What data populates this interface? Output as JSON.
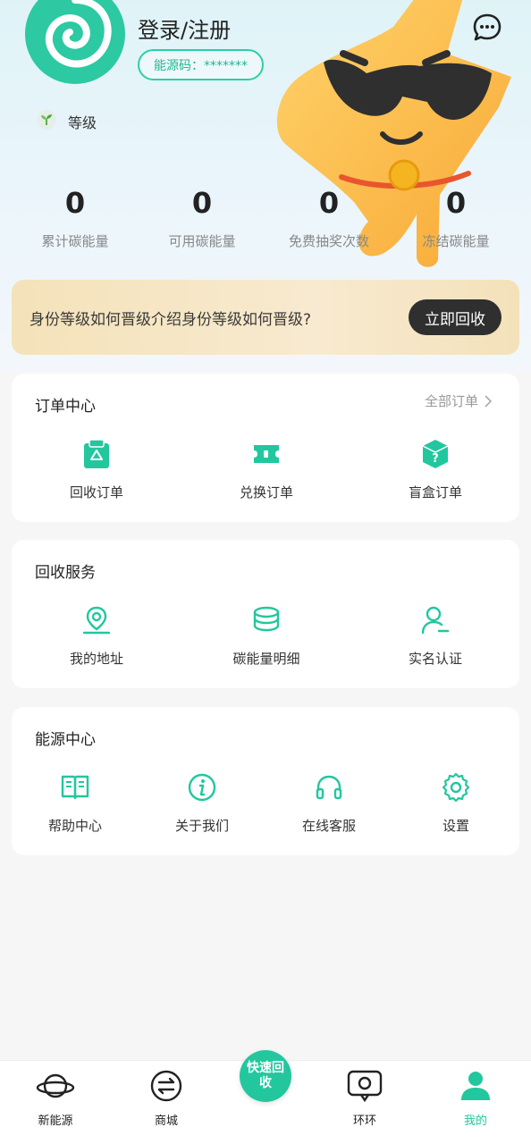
{
  "profile": {
    "login_label": "登录/注册",
    "energy_code": "能源码：*******",
    "level_label": "等级"
  },
  "stats": [
    {
      "value": "0",
      "label": "累计碳能量"
    },
    {
      "value": "0",
      "label": "可用碳能量"
    },
    {
      "value": "0",
      "label": "免费抽奖次数"
    },
    {
      "value": "0",
      "label": "冻结碳能量"
    }
  ],
  "banner": {
    "text": "身份等级如何晋级介绍身份等级如何晋级?",
    "button": "立即回收"
  },
  "orders": {
    "title": "订单中心",
    "link": "全部订单",
    "items": [
      {
        "label": "回收订单",
        "icon": "recycle-bin-icon"
      },
      {
        "label": "兑换订单",
        "icon": "ticket-icon"
      },
      {
        "label": "盲盒订单",
        "icon": "mystery-box-icon"
      }
    ]
  },
  "recycle": {
    "title": "回收服务",
    "items": [
      {
        "label": "我的地址",
        "icon": "location-pin-icon"
      },
      {
        "label": "碳能量明细",
        "icon": "coin-stack-icon"
      },
      {
        "label": "实名认证",
        "icon": "user-verify-icon"
      }
    ]
  },
  "energy": {
    "title": "能源中心",
    "items": [
      {
        "label": "帮助中心",
        "icon": "book-icon"
      },
      {
        "label": "关于我们",
        "icon": "info-icon"
      },
      {
        "label": "在线客服",
        "icon": "headset-icon"
      },
      {
        "label": "设置",
        "icon": "gear-icon"
      }
    ]
  },
  "tabbar": {
    "items": [
      {
        "label": "新能源",
        "icon": "planet-icon"
      },
      {
        "label": "商城",
        "icon": "exchange-icon"
      },
      {
        "label": "快速回收",
        "icon": "quick-recycle-button"
      },
      {
        "label": "环环",
        "icon": "chat-bubble-icon"
      },
      {
        "label": "我的",
        "icon": "user-icon"
      }
    ],
    "active_color": "#22c79e"
  },
  "colors": {
    "accent": "#22c79e",
    "banner_bg": "#f4e2b9",
    "banner_button": "#2f2f2f"
  }
}
